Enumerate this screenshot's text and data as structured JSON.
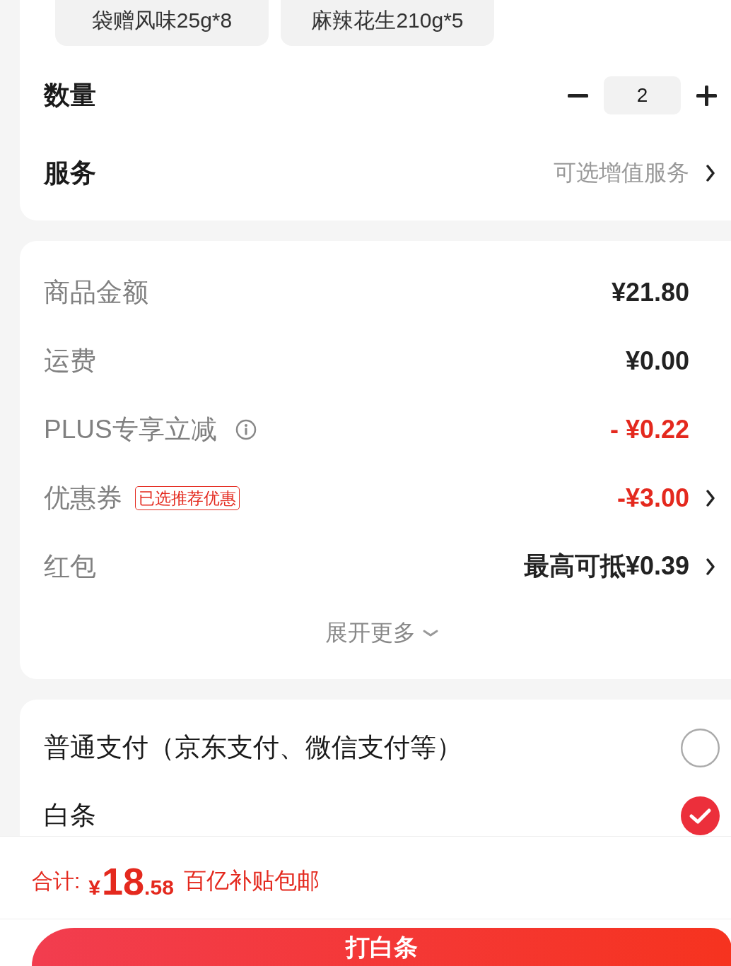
{
  "spec_options": [
    {
      "label": "袋赠风味25g*8",
      "selected": false
    },
    {
      "label": "麻辣花生210g*5",
      "selected": false
    }
  ],
  "quantity": {
    "label": "数量",
    "value": "2"
  },
  "service": {
    "label": "服务",
    "value": "可选增值服务"
  },
  "price_rows": [
    {
      "label": "商品金额",
      "info": false,
      "value": "¥21.80",
      "discount": false,
      "chevron": false
    },
    {
      "label": "运费",
      "info": false,
      "value": "¥0.00",
      "discount": false,
      "chevron": false
    },
    {
      "label": "PLUS专享立减",
      "info": true,
      "value": "- ¥0.22",
      "discount": true,
      "chevron": false
    },
    {
      "label": "优惠券",
      "info": false,
      "tag": "已选推荐优惠",
      "value": "-¥3.00",
      "discount": true,
      "chevron": true
    },
    {
      "label": "红包",
      "info": false,
      "value": "最高可抵¥0.39",
      "discount": false,
      "chevron": true
    }
  ],
  "expand": {
    "label": "展开更多"
  },
  "payment_methods": [
    {
      "label": "普通支付（京东支付、微信支付等）",
      "selected": false
    },
    {
      "label": "白条",
      "selected": true
    }
  ],
  "footer": {
    "total_label": "合计:",
    "currency": "¥",
    "integer": "18",
    "decimal": ".58",
    "note": "百亿补贴包邮",
    "submit_button": "打白条"
  }
}
